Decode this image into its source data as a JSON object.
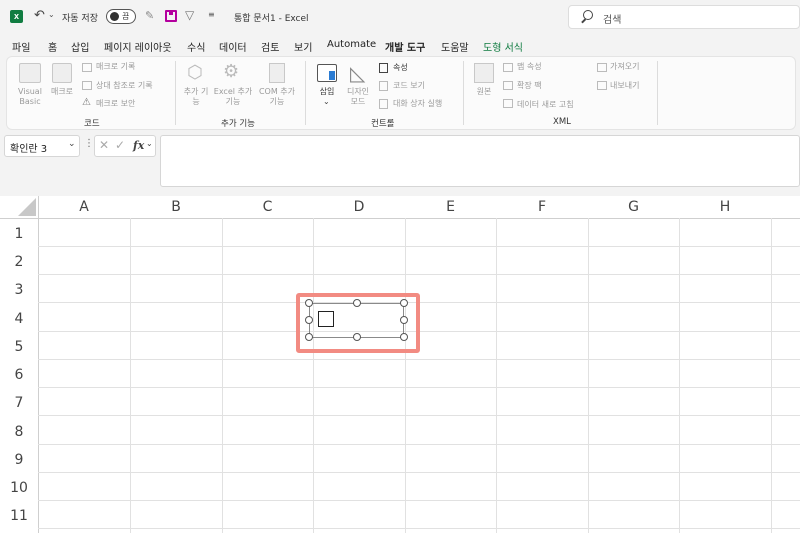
{
  "titlebar": {
    "autosave_label": "자동 저장",
    "autosave_state": "끔",
    "doc_title": "통합 문서1",
    "app_name": "Excel",
    "search_placeholder": "검색"
  },
  "tabs": [
    "파일",
    "홈",
    "삽입",
    "페이지 레이아웃",
    "수식",
    "데이터",
    "검토",
    "보기",
    "Automate",
    "개발 도구",
    "도움말",
    "도형 서식"
  ],
  "ribbon": {
    "code": {
      "visual_basic": "Visual Basic",
      "macro": "매크로",
      "record_macro": "매크로 기록",
      "relative_refs": "상대 참조로 기록",
      "macro_security": "매크로 보안",
      "label": "코드"
    },
    "addins": {
      "addins": "추가 기능",
      "excel_addins": "Excel 추가 기능",
      "com_addins": "COM 추가 기능",
      "label": "추가 기능"
    },
    "controls": {
      "insert": "삽입",
      "design_mode": "디자인 모드",
      "properties": "속성",
      "view_code": "코드 보기",
      "run_dialog": "대화 상자 실행",
      "label": "컨트롤"
    },
    "xml": {
      "source": "원본",
      "map_properties": "맵 속성",
      "expansion_packs": "확장 팩",
      "refresh_data": "데이터 새로 고침",
      "import": "가져오기",
      "export": "내보내기",
      "label": "XML"
    }
  },
  "formula_bar": {
    "name_box": "확인란 3",
    "fx": "fx",
    "formula": ""
  },
  "grid": {
    "columns": [
      "A",
      "B",
      "C",
      "D",
      "E",
      "F",
      "G",
      "H"
    ],
    "rows": [
      "1",
      "2",
      "3",
      "4",
      "5",
      "6",
      "7",
      "8",
      "9",
      "10",
      "11"
    ]
  },
  "colors": {
    "excel_green": "#107c41",
    "highlight": "#f28b82"
  }
}
